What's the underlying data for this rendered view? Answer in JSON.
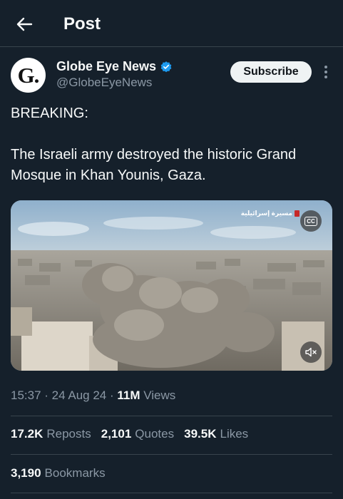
{
  "header": {
    "title": "Post"
  },
  "author": {
    "avatar_letter": "G.",
    "name": "Globe Eye News",
    "handle": "@GlobeEyeNews",
    "verified_color": "#1d9bf0"
  },
  "actions": {
    "subscribe_label": "Subscribe"
  },
  "post": {
    "line1": "BREAKING:",
    "line2": "The Israeli army destroyed the historic Grand Mosque in Khan Younis, Gaza."
  },
  "media": {
    "watermark": "مسيرة إسرائيلية",
    "cc_label": "CC"
  },
  "meta": {
    "time": "15:37",
    "date": "24 Aug 24",
    "views_count": "11M",
    "views_label": "Views"
  },
  "stats": {
    "reposts_count": "17.2K",
    "reposts_label": "Reposts",
    "quotes_count": "2,101",
    "quotes_label": "Quotes",
    "likes_count": "39.5K",
    "likes_label": "Likes",
    "bookmarks_count": "3,190",
    "bookmarks_label": "Bookmarks"
  },
  "colors": {
    "background": "#15202b",
    "muted_text": "#8b98a5",
    "divider": "#38444d"
  }
}
